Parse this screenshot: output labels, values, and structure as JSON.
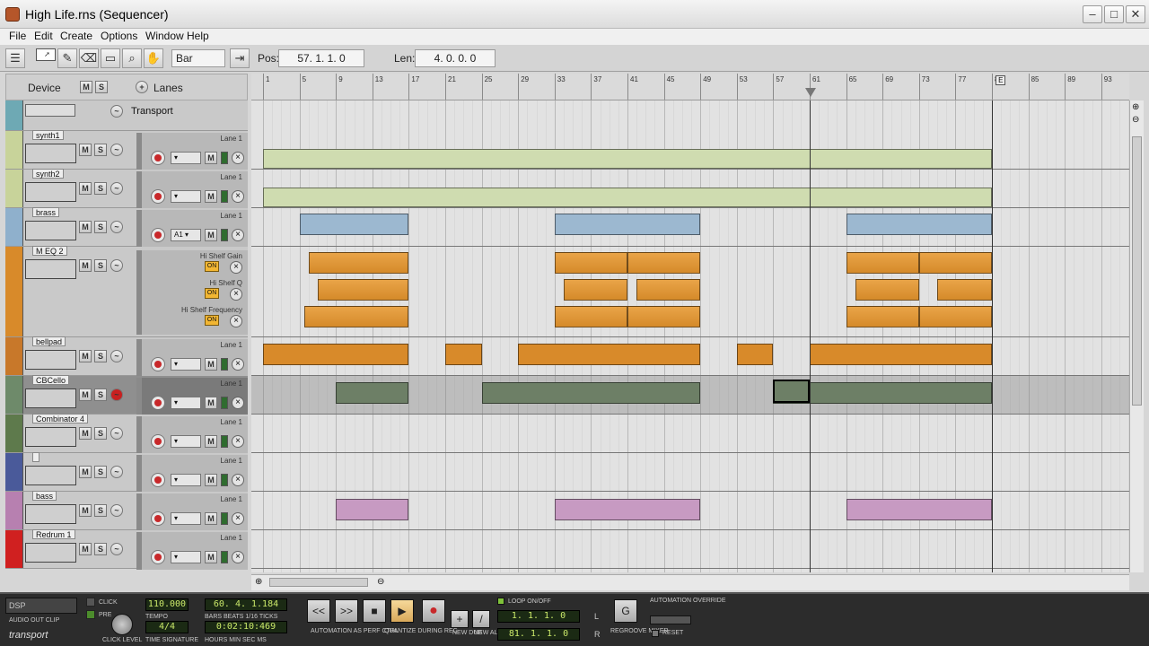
{
  "window": {
    "title": "High Life.rns (Sequencer)"
  },
  "menu": [
    "File",
    "Edit",
    "Create",
    "Options",
    "Window",
    "Help"
  ],
  "toolbar": {
    "snap_value": "Bar",
    "pos_label": "Pos:",
    "pos_value": "57.  1.  1.    0",
    "len_label": "Len:",
    "len_value": "4.  0.  0.    0"
  },
  "header": {
    "device": "Device",
    "m": "M",
    "s": "S",
    "lanes": "Lanes",
    "transport": "Transport"
  },
  "ruler": {
    "marks": [
      "1",
      "5",
      "9",
      "13",
      "17",
      "21",
      "25",
      "29",
      "33",
      "37",
      "41",
      "45",
      "49",
      "53",
      "57",
      "61",
      "65",
      "69",
      "73",
      "77",
      "81",
      "85",
      "89",
      "93"
    ],
    "end_label": "E"
  },
  "tracks": [
    {
      "name": "synth1",
      "lane": "Lane 1",
      "color": "#c8d39a"
    },
    {
      "name": "synth2",
      "lane": "Lane 1",
      "color": "#c8d39a"
    },
    {
      "name": "brass",
      "lane": "Lane 1",
      "color": "#8fb0cc",
      "selector": "A1"
    },
    {
      "name": "M EQ 2",
      "color": "#d88a2a",
      "automation": [
        "Hi Shelf Gain",
        "Hi Shelf Q",
        "Hi Shelf Frequency"
      ],
      "on": "ON"
    },
    {
      "name": "bellpad",
      "lane": "Lane 1",
      "color": "#c8782a"
    },
    {
      "name": "CBCello",
      "lane": "Lane 1",
      "color": "#6e8a6a"
    },
    {
      "name": "Combinator 4",
      "lane": "Lane 1",
      "color": "#5e7a4c"
    },
    {
      "name": "",
      "lane": "Lane 1",
      "color": "#4a5a9a"
    },
    {
      "name": "bass",
      "lane": "Lane 1",
      "color": "#b780b0"
    },
    {
      "name": "Redrum 1",
      "lane": "Lane 1",
      "color": "#d02020"
    }
  ],
  "transport": {
    "dsp": "DSP",
    "audio_out_clip": "AUDIO OUT CLIP",
    "brand": "transport",
    "click": "CLICK",
    "pre": "PRE",
    "click_level": "CLICK LEVEL",
    "tempo": "110.000",
    "tempo_label": "TEMPO",
    "sig": "4/4",
    "sig_label": "TIME SIGNATURE",
    "bars": "60.  4.  1.184",
    "bars_label": "BARS  BEATS  1/16  TICKS",
    "time": "0:02:10:469",
    "time_label": "HOURS   MIN   SEC     MS",
    "rew": "<<",
    "ffw": ">>",
    "stop": "■",
    "play": "▶",
    "automation_perf": "AUTOMATION AS PERF CTRL",
    "quantize": "QUANTIZE DURING REC",
    "new_dub": "NEW DUB",
    "new_alt": "NEW ALT",
    "loop": "LOOP ON/OFF",
    "loop_l": "1.  1.  1.    0",
    "loop_r": "81.  1.  1.    0",
    "L": "L",
    "R": "R",
    "regroove": "REGROOVE MIXER",
    "auto_override": "AUTOMATION OVERRIDE",
    "reset": "RESET"
  }
}
